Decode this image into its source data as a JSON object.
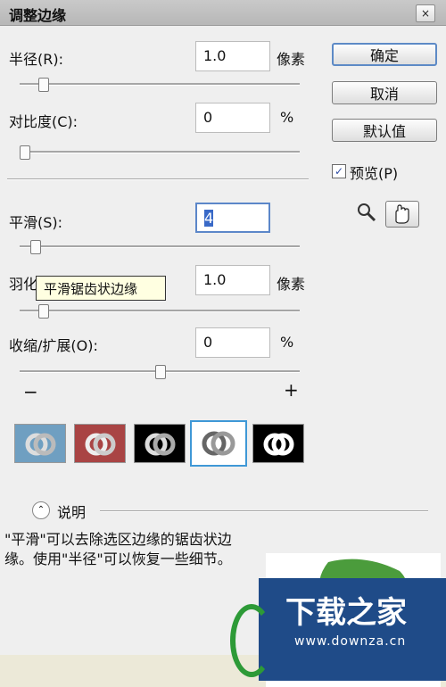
{
  "window": {
    "title": "调整边缘",
    "close_label": "×"
  },
  "controls": {
    "radius": {
      "label": "半径(R):",
      "value": "1.0",
      "unit": "像素",
      "slider": 0.07
    },
    "contrast": {
      "label": "对比度(C):",
      "value": "0",
      "unit": "%",
      "slider": 0.0
    },
    "smooth": {
      "label": "平滑(S):",
      "value": "4",
      "unit": "",
      "slider": 0.04
    },
    "feather": {
      "label": "羽化(F):",
      "value": "1.0",
      "unit": "像素",
      "slider": 0.07
    },
    "contract": {
      "label": "收缩/扩展(O):",
      "value": "0",
      "unit": "%",
      "slider": 0.5
    }
  },
  "slider_ends": {
    "minus": "−",
    "plus": "+"
  },
  "tooltip": "平滑锯齿状边缘",
  "buttons": {
    "ok": "确定",
    "cancel": "取消",
    "default": "默认值"
  },
  "preview": {
    "label": "预览(P)",
    "checked": true,
    "check_mark": "✓"
  },
  "view_modes": {
    "selected_index": 3,
    "items": [
      "standard",
      "quick-mask",
      "on-black",
      "on-white",
      "mask"
    ]
  },
  "description": {
    "toggle": "说明",
    "text": "\"平滑\"可以去除选区边缘的锯齿状边缘。使用\"半径\"可以恢复一些细节。"
  },
  "watermark": {
    "title": "下载之家",
    "site": "www.downza.cn"
  },
  "colors": {
    "accent": "#5d8ac6",
    "selection": "#3969c7",
    "watermark_bg": "#1f4b88"
  }
}
